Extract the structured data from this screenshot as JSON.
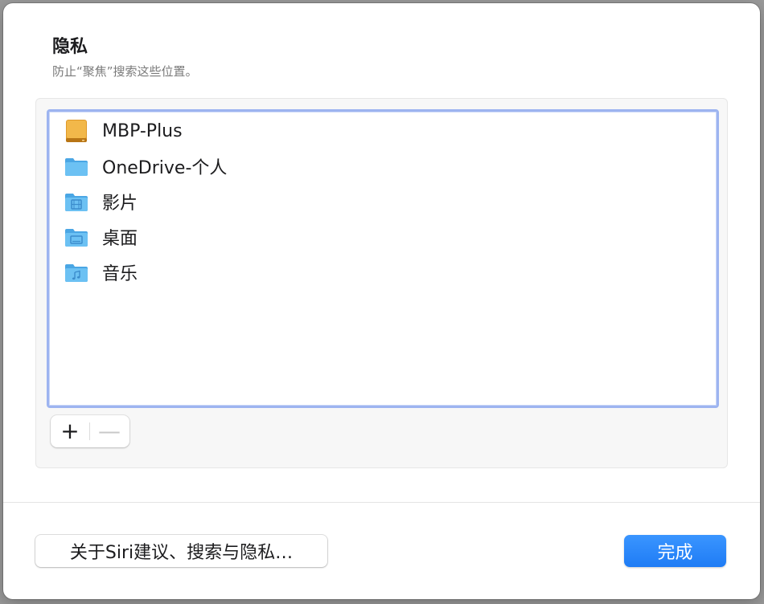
{
  "dialog": {
    "title": "隐私",
    "subtitle": "防止“聚焦”搜索这些位置。"
  },
  "excluded_locations": [
    {
      "label": "MBP-Plus",
      "icon": "external-drive-icon"
    },
    {
      "label": "OneDrive-个人",
      "icon": "folder-icon"
    },
    {
      "label": "影片",
      "icon": "movies-folder-icon"
    },
    {
      "label": "桌面",
      "icon": "desktop-folder-icon"
    },
    {
      "label": "音乐",
      "icon": "music-folder-icon"
    }
  ],
  "list_controls": {
    "add_label": "+",
    "remove_label": "—"
  },
  "footer": {
    "about_button": "关于Siri建议、搜索与隐私…",
    "done_button": "完成"
  },
  "colors": {
    "accent": "#1f7cf5",
    "folder": "#5fb8ef",
    "drive": "#e0a030",
    "focus_ring": "#9db4f0"
  }
}
